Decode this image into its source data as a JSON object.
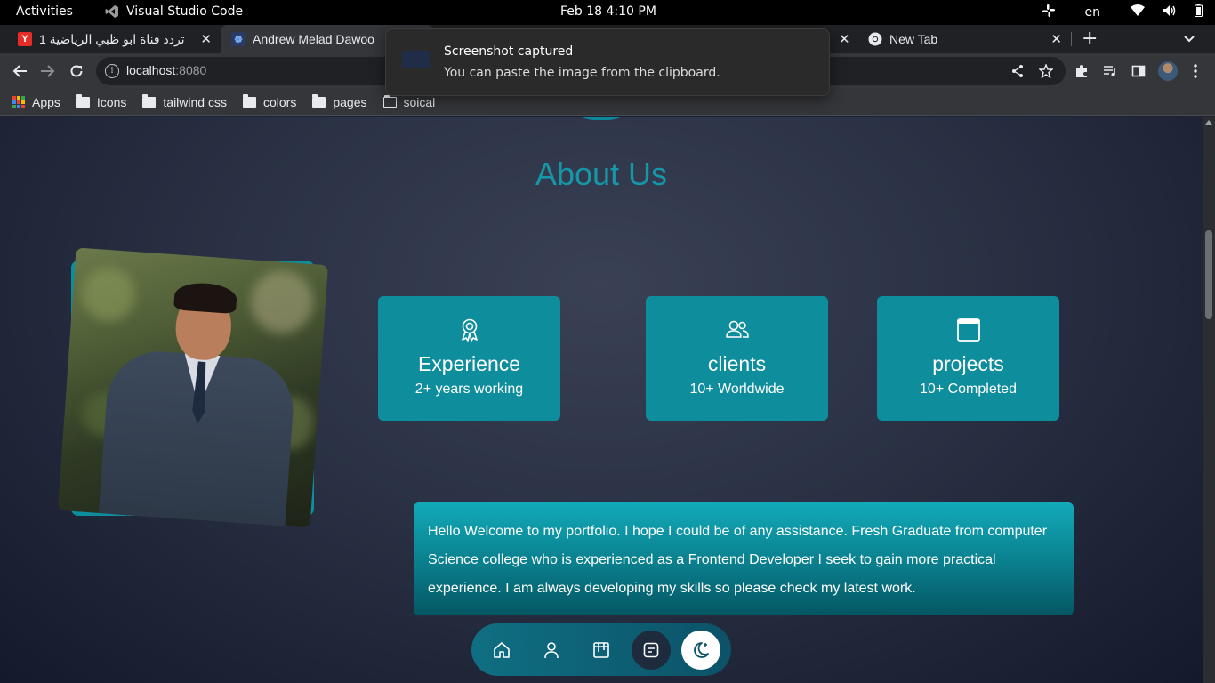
{
  "system": {
    "activities": "Activities",
    "app_name": "Visual Studio Code",
    "clock": "Feb 18   4:10 PM",
    "language": "en"
  },
  "tabs": [
    {
      "title": "تردد قناة ابو ظبي الرياضية 1",
      "favicon": "Y",
      "favicon_color": "#e52d27"
    },
    {
      "title": "Andrew Melad Dawoo",
      "favicon": "portfolio",
      "active": true
    },
    {
      "title": "New Tab",
      "favicon": "chrome"
    }
  ],
  "toolbar": {
    "url_host": "localhost",
    "url_port": ":8080"
  },
  "bookmarks": [
    {
      "label": "Apps",
      "icon": "apps-grid-icon"
    },
    {
      "label": "Icons",
      "icon": "folder-icon"
    },
    {
      "label": "tailwind css",
      "icon": "folder-icon"
    },
    {
      "label": "colors",
      "icon": "folder-icon"
    },
    {
      "label": "pages",
      "icon": "folder-icon"
    },
    {
      "label": "soical",
      "icon": "folder-open-icon"
    }
  ],
  "notification": {
    "title": "Screenshot captured",
    "body": "You can paste the image from the clipboard."
  },
  "about": {
    "title": "About Us",
    "cards": [
      {
        "title": "Experience",
        "subtitle": "2+ years working",
        "icon": "award-icon"
      },
      {
        "title": "clients",
        "subtitle": "10+ Worldwide",
        "icon": "users-icon"
      },
      {
        "title": "projects",
        "subtitle": "10+ Completed",
        "icon": "window-icon"
      }
    ],
    "bio": "Hello Welcome to my portfolio. I hope I could be of any assistance. Fresh Graduate from computer Science college who is experienced as a Frontend Developer I seek to gain more practical experience. I am always developing my skills so please check my latest work."
  },
  "colors": {
    "accent": "#0e8d9c",
    "title": "#1597a8",
    "background": "#1c2233"
  },
  "dock": [
    {
      "icon": "home-icon"
    },
    {
      "icon": "user-icon"
    },
    {
      "icon": "projects-icon"
    },
    {
      "icon": "message-icon",
      "active": true
    },
    {
      "icon": "dark-mode-icon",
      "highlight": true
    }
  ]
}
